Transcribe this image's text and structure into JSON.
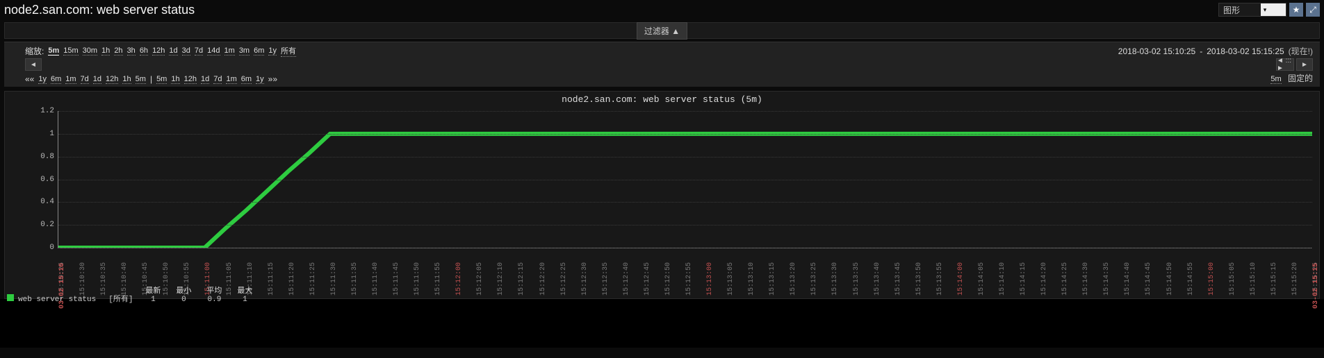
{
  "header": {
    "title": "node2.san.com: web server status",
    "view_select": "图形",
    "icons": [
      "star",
      "fullscreen"
    ]
  },
  "filter_button": "过滤器 ▲",
  "zoom": {
    "label": "缩放:",
    "options": [
      "5m",
      "15m",
      "30m",
      "1h",
      "2h",
      "3h",
      "6h",
      "12h",
      "1d",
      "3d",
      "7d",
      "14d",
      "1m",
      "3m",
      "6m",
      "1y",
      "所有"
    ],
    "active": "5m"
  },
  "time_range": {
    "from": "2018-03-02 15:10:25",
    "to": "2018-03-02 15:15:25",
    "now_label": "(现在!)"
  },
  "nav": {
    "back_groups": [
      {
        "prefix": "««",
        "items": [
          "1y",
          "6m",
          "1m",
          "7d",
          "1d",
          "12h",
          "1h",
          "5m"
        ]
      },
      {
        "prefix": "|",
        "items": [
          "5m",
          "1h",
          "12h",
          "1d",
          "7d",
          "1m",
          "6m",
          "1y"
        ],
        "suffix": "»»"
      }
    ],
    "fixed_label": "固定的",
    "fixed_current": "5m"
  },
  "chart_data": {
    "type": "line",
    "title": "node2.san.com: web server status (5m)",
    "ylabel": "",
    "xlabel": "",
    "ylim": [
      0,
      1.2
    ],
    "yticks": [
      0,
      0.2,
      0.4,
      0.6,
      0.8,
      1.0,
      1.2
    ],
    "x": [
      "15:10:25",
      "15:10:30",
      "15:10:35",
      "15:10:40",
      "15:10:45",
      "15:10:50",
      "15:10:55",
      "15:11:00",
      "15:11:05",
      "15:11:10",
      "15:11:15",
      "15:11:20",
      "15:11:25",
      "15:11:30",
      "15:11:35",
      "15:11:40",
      "15:11:45",
      "15:11:50",
      "15:11:55",
      "15:12:00",
      "15:12:05",
      "15:12:10",
      "15:12:15",
      "15:12:20",
      "15:12:25",
      "15:12:30",
      "15:12:35",
      "15:12:40",
      "15:12:45",
      "15:12:50",
      "15:12:55",
      "15:13:00",
      "15:13:05",
      "15:13:10",
      "15:13:15",
      "15:13:20",
      "15:13:25",
      "15:13:30",
      "15:13:35",
      "15:13:40",
      "15:13:45",
      "15:13:50",
      "15:13:55",
      "15:14:00",
      "15:14:05",
      "15:14:10",
      "15:14:15",
      "15:14:20",
      "15:14:25",
      "15:14:30",
      "15:14:35",
      "15:14:40",
      "15:14:45",
      "15:14:50",
      "15:14:55",
      "15:15:00",
      "15:15:05",
      "15:15:10",
      "15:15:15",
      "15:15:20",
      "15:15:25"
    ],
    "series": [
      {
        "name": "web server status",
        "color": "#2ecc40",
        "values": [
          0,
          0,
          0,
          0,
          0,
          0,
          0,
          0,
          0.17,
          0.33,
          0.5,
          0.67,
          0.83,
          1,
          1,
          1,
          1,
          1,
          1,
          1,
          1,
          1,
          1,
          1,
          1,
          1,
          1,
          1,
          1,
          1,
          1,
          1,
          1,
          1,
          1,
          1,
          1,
          1,
          1,
          1,
          1,
          1,
          1,
          1,
          1,
          1,
          1,
          1,
          1,
          1,
          1,
          1,
          1,
          1,
          1,
          1,
          1,
          1,
          1,
          1,
          1
        ]
      }
    ],
    "minute_marks": [
      "15:11:00",
      "15:12:00",
      "15:13:00",
      "15:14:00",
      "15:15:00"
    ],
    "edge_labels": {
      "left": "03-02 15:10",
      "right": "03-02 15:15"
    }
  },
  "legend": {
    "name": "web server status",
    "scope": "[所有]",
    "stats": {
      "最新": "1",
      "最小": "0",
      "平均": "0.9",
      "最大": "1"
    }
  }
}
